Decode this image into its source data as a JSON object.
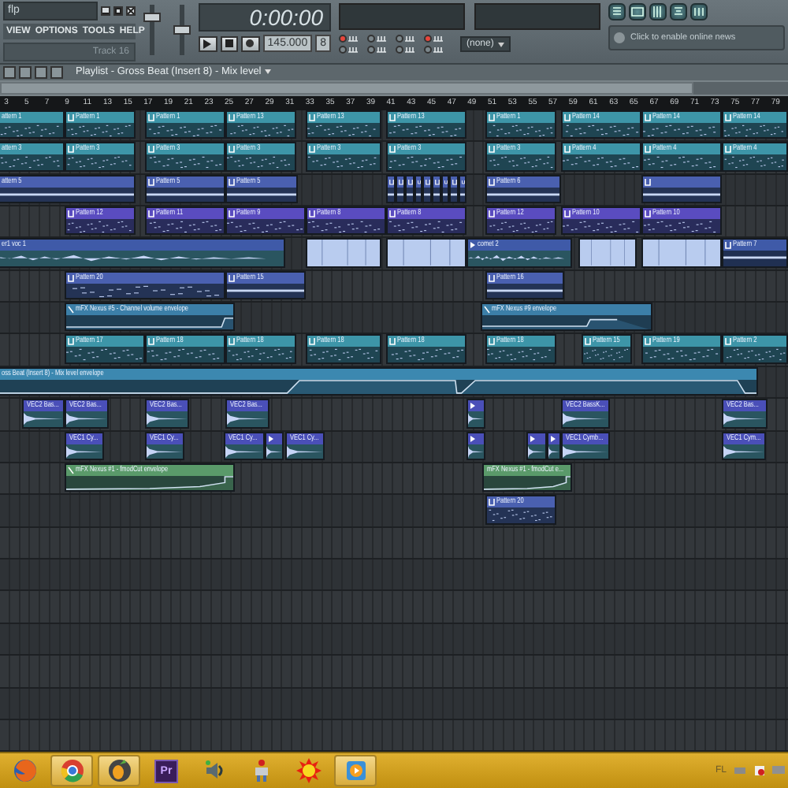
{
  "window": {
    "title": "flp"
  },
  "menu": [
    "VIEW",
    "OPTIONS",
    "TOOLS",
    "HELP"
  ],
  "hint": "Track 16",
  "master": {
    "volume": {
      "level": 0.8
    },
    "pitch": {
      "level": 0.5
    }
  },
  "transport": {
    "time": "0:00:00",
    "tempo": "145.000",
    "pattern": "8"
  },
  "toggles": [
    {
      "on": true
    },
    {
      "on": false
    },
    {
      "on": false
    },
    {
      "on": true
    },
    {
      "on": false
    },
    {
      "on": false
    },
    {
      "on": false
    },
    {
      "on": false
    }
  ],
  "snap": "(none)",
  "news": "Click to enable online news",
  "playlist": {
    "title": "Playlist - Gross Beat (Insert 8) - Mix level",
    "ruler": [
      "3",
      "5",
      "7",
      "9",
      "11",
      "13",
      "15",
      "17",
      "19",
      "21",
      "23",
      "25",
      "27",
      "29",
      "31",
      "33",
      "35",
      "37",
      "39",
      "41",
      "43",
      "45",
      "47",
      "49",
      "51",
      "53",
      "55",
      "57",
      "59",
      "61",
      "63",
      "65",
      "67",
      "69",
      "71",
      "73",
      "75",
      "77",
      "79"
    ],
    "tracks": [
      {
        "color": "#3d95a8",
        "clips": [
          {
            "kind": "pattern",
            "label": "attern 1"
          },
          {
            "kind": "pattern",
            "label": "Pattern 1"
          },
          {
            "kind": "pattern",
            "label": "Pattern 1"
          },
          {
            "kind": "pattern",
            "label": "Pattern 13"
          },
          {
            "kind": "pattern",
            "label": "Pattern 13"
          },
          {
            "kind": "pattern",
            "label": "Pattern 13"
          },
          {
            "kind": "pattern",
            "label": "Pattern 1"
          },
          {
            "kind": "pattern",
            "label": "Pattern 14"
          },
          {
            "kind": "pattern",
            "label": "Pattern 14"
          },
          {
            "kind": "pattern",
            "label": "Pattern 14"
          }
        ]
      },
      {
        "color": "#3d95a8",
        "clips": [
          {
            "kind": "pattern",
            "label": "attern 3"
          },
          {
            "kind": "pattern",
            "label": "Pattern 3"
          },
          {
            "kind": "pattern",
            "label": "Pattern 3"
          },
          {
            "kind": "pattern",
            "label": "Pattern 3"
          },
          {
            "kind": "pattern",
            "label": "Pattern 3"
          },
          {
            "kind": "pattern",
            "label": "Pattern 3"
          },
          {
            "kind": "pattern",
            "label": "Pattern 3"
          },
          {
            "kind": "pattern",
            "label": "Pattern 4"
          },
          {
            "kind": "pattern",
            "label": "Pattern 4"
          },
          {
            "kind": "pattern",
            "label": "Pattern 4"
          }
        ]
      },
      {
        "color": "#4a60b0",
        "clips": [
          {
            "kind": "beat",
            "label": "attern 5"
          },
          {
            "kind": "beat",
            "label": "Pattern 5"
          },
          {
            "kind": "beat",
            "label": "Pattern 5"
          },
          {
            "kind": "beat"
          },
          {
            "kind": "beat"
          },
          {
            "kind": "beat"
          },
          {
            "kind": "beat"
          },
          {
            "kind": "beat"
          },
          {
            "kind": "beat"
          },
          {
            "kind": "beat"
          },
          {
            "kind": "beat"
          },
          {
            "kind": "beat"
          },
          {
            "kind": "beat",
            "label": "Pattern 6"
          },
          {
            "kind": "beat"
          }
        ]
      },
      {
        "color": "#5a4cc0",
        "clips": [
          {
            "kind": "pattern",
            "label": "Pattern 12"
          },
          {
            "kind": "pattern",
            "label": "Pattern 11"
          },
          {
            "kind": "pattern",
            "label": "Pattern 9"
          },
          {
            "kind": "pattern",
            "label": "Pattern 8"
          },
          {
            "kind": "pattern",
            "label": "Pattern 8"
          },
          {
            "kind": "pattern",
            "label": "Pattern 12"
          },
          {
            "kind": "pattern",
            "label": "Pattern 10"
          },
          {
            "kind": "pattern",
            "label": "Pattern 10"
          }
        ]
      },
      {
        "color": "#3f5aa8",
        "clips": [
          {
            "kind": "audio",
            "label": "er1 voc 1"
          },
          {
            "kind": "slice"
          },
          {
            "kind": "slice"
          },
          {
            "kind": "audio",
            "label": "comet 2"
          },
          {
            "kind": "slice"
          },
          {
            "kind": "slice"
          },
          {
            "kind": "beat",
            "label": "Pattern 7"
          }
        ]
      },
      {
        "color": "#4a60b0",
        "clips": [
          {
            "kind": "pattern",
            "label": "Pattern 20"
          },
          {
            "kind": "beat",
            "label": "Pattern 15"
          },
          {
            "kind": "beat",
            "label": "Pattern 16"
          }
        ]
      },
      {
        "color": "#3c7fa8",
        "clips": [
          {
            "kind": "automation",
            "label": "mFX Nexus #5 - Channel volume envelope"
          },
          {
            "kind": "automation",
            "label": "mFX Nexus #9 envelope"
          }
        ]
      },
      {
        "color": "#3d95a8",
        "clips": [
          {
            "kind": "pattern",
            "label": "Pattern 17"
          },
          {
            "kind": "pattern",
            "label": "Pattern 18"
          },
          {
            "kind": "pattern",
            "label": "Pattern 18"
          },
          {
            "kind": "pattern",
            "label": "Pattern 18"
          },
          {
            "kind": "pattern",
            "label": "Pattern 18"
          },
          {
            "kind": "pattern",
            "label": "Pattern 18"
          },
          {
            "kind": "pattern",
            "label": "Pattern 15"
          },
          {
            "kind": "pattern",
            "label": "Pattern 19"
          },
          {
            "kind": "pattern",
            "label": "Pattern 2"
          }
        ]
      },
      {
        "color": "#3c88b0",
        "clips": [
          {
            "kind": "automation",
            "label": "oss Beat (Insert 8) - Mix level envelope"
          }
        ]
      },
      {
        "color": "#4a4fb8",
        "clips": [
          {
            "kind": "audio",
            "label": "VEC2 Bas..."
          },
          {
            "kind": "audio",
            "label": "VEC2 Bas..."
          },
          {
            "kind": "audio",
            "label": "VEC2 Bas..."
          },
          {
            "kind": "audio",
            "label": "VEC2 Bas..."
          },
          {
            "kind": "audio"
          },
          {
            "kind": "audio",
            "label": "VEC2 BassK..."
          },
          {
            "kind": "audio",
            "label": "VEC2 Bas..."
          }
        ]
      },
      {
        "color": "#4a4fb8",
        "clips": [
          {
            "kind": "audio",
            "label": "VEC1 Cy..."
          },
          {
            "kind": "audio",
            "label": "VEC1 Cy..."
          },
          {
            "kind": "audio",
            "label": "VEC1 Cy..."
          },
          {
            "kind": "audio"
          },
          {
            "kind": "audio",
            "label": "VEC1 Cy..."
          },
          {
            "kind": "audio"
          },
          {
            "kind": "audio"
          },
          {
            "kind": "audio"
          },
          {
            "kind": "audio",
            "label": "VEC1 Cymb..."
          },
          {
            "kind": "audio",
            "label": "VEC1 Cym..."
          }
        ]
      },
      {
        "color": "#5a9a6a",
        "clips": [
          {
            "kind": "automation",
            "label": "mFX Nexus #1 - fmodCut envelope"
          },
          {
            "kind": "automation",
            "label": "mFX Nexus #1 - fmodCut e..."
          }
        ]
      },
      {
        "color": "#4a60b0",
        "clips": [
          {
            "kind": "pattern",
            "label": "Pattern 20"
          }
        ]
      }
    ]
  },
  "taskbar": {
    "apps": [
      {
        "kind": "firefox",
        "active": false
      },
      {
        "kind": "chrome",
        "active": true
      },
      {
        "kind": "fl",
        "active": true
      },
      {
        "kind": "premiere",
        "label": "Pr",
        "active": false
      },
      {
        "kind": "speaker",
        "active": false
      },
      {
        "kind": "figure",
        "active": false
      },
      {
        "kind": "sun",
        "active": false
      },
      {
        "kind": "player",
        "active": true
      }
    ],
    "language": "FL"
  }
}
